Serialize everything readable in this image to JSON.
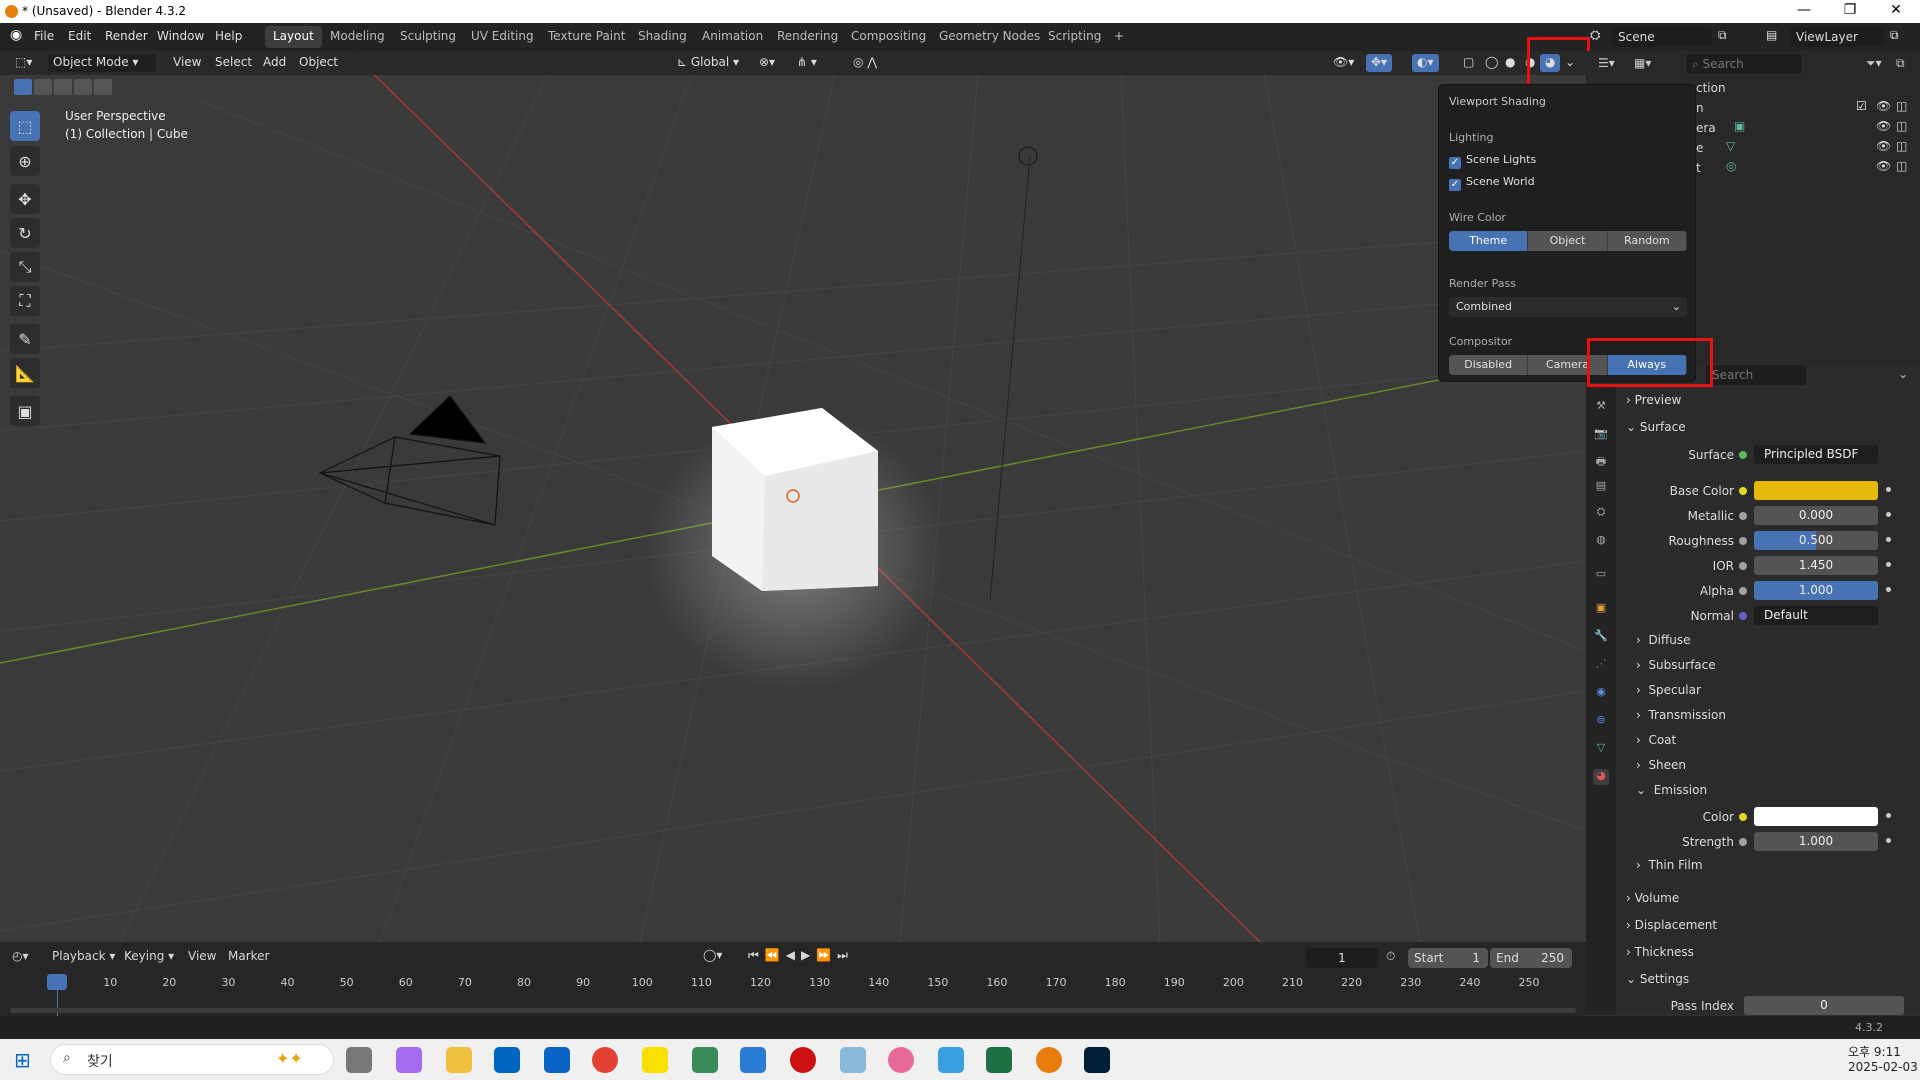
{
  "title": "* (Unsaved) - Blender 4.3.2",
  "window_controls": [
    "—",
    "❐",
    "✕"
  ],
  "menu": [
    "File",
    "Edit",
    "Render",
    "Window",
    "Help"
  ],
  "workspaces": [
    "Layout",
    "Modeling",
    "Sculpting",
    "UV Editing",
    "Texture Paint",
    "Shading",
    "Animation",
    "Rendering",
    "Compositing",
    "Geometry Nodes",
    "Scripting",
    "+"
  ],
  "scene": "Scene",
  "view_layer": "ViewLayer",
  "viewport_header": {
    "mode": "Object Mode",
    "menus": [
      "View",
      "Select",
      "Add",
      "Object"
    ],
    "orientation": "Global"
  },
  "viewport_overlay": {
    "line1": "User Perspective",
    "line2": "(1) Collection | Cube"
  },
  "outliner": {
    "search_placeholder": "Search",
    "rows": [
      "ction",
      "n",
      "era",
      "e",
      "t"
    ]
  },
  "shading_popover": {
    "title": "Viewport Shading",
    "lighting_label": "Lighting",
    "scene_lights": "Scene Lights",
    "scene_world": "Scene World",
    "wire_color_label": "Wire Color",
    "wire_options": [
      "Theme",
      "Object",
      "Random"
    ],
    "render_pass_label": "Render Pass",
    "render_pass": "Combined",
    "compositor_label": "Compositor",
    "compositor_options": [
      "Disabled",
      "Camera",
      "Always"
    ]
  },
  "properties": {
    "search_placeholder": "Search",
    "preview": "Preview",
    "surface_section": "Surface",
    "surface": {
      "label": "Surface",
      "value": "Principled BSDF"
    },
    "rows": [
      {
        "label": "Base Color",
        "value": ""
      },
      {
        "label": "Metallic",
        "value": "0.000"
      },
      {
        "label": "Roughness",
        "value": "0.500"
      },
      {
        "label": "IOR",
        "value": "1.450"
      },
      {
        "label": "Alpha",
        "value": "1.000"
      },
      {
        "label": "Normal",
        "value": "Default"
      }
    ],
    "subsections": [
      "Diffuse",
      "Subsurface",
      "Specular",
      "Transmission",
      "Coat",
      "Sheen"
    ],
    "emission": "Emission",
    "emission_rows": [
      {
        "label": "Color",
        "value": ""
      },
      {
        "label": "Strength",
        "value": "1.000"
      }
    ],
    "thin_film": "Thin Film",
    "sections": [
      "Volume",
      "Displacement",
      "Thickness"
    ],
    "settings": "Settings",
    "pass_index": {
      "label": "Pass Index",
      "value": "0"
    },
    "colors": {
      "base_color": "#e3b90c",
      "emission_color": "#ffffff"
    }
  },
  "timeline": {
    "menus": [
      "Playback",
      "Keying",
      "View",
      "Marker"
    ],
    "current_frame": "1",
    "start_label": "Start",
    "start": "1",
    "end_label": "End",
    "end": "250",
    "ticks": [
      "1",
      "10",
      "20",
      "30",
      "40",
      "50",
      "60",
      "70",
      "80",
      "90",
      "100",
      "110",
      "120",
      "130",
      "140",
      "150",
      "160",
      "170",
      "180",
      "190",
      "200",
      "210",
      "220",
      "230",
      "240",
      "250"
    ]
  },
  "status": {
    "version": "4.3.2"
  },
  "taskbar": {
    "search": "찾기",
    "time": "오후 9:11",
    "date": "2025-02-03"
  }
}
